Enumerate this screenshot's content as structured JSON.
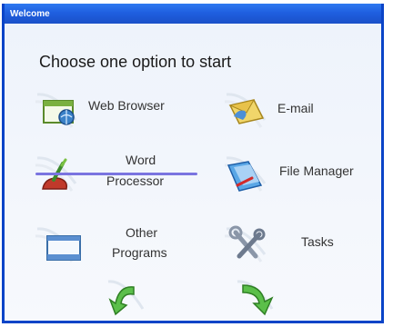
{
  "window": {
    "title": "Welcome"
  },
  "heading": "Choose one option to start",
  "options": [
    {
      "label": "Web Browser",
      "icon": "browser-window-icon"
    },
    {
      "label": "E-mail",
      "icon": "envelope-icon"
    },
    {
      "label_line1": "Word",
      "label_line2": "Processor",
      "icon": "word-processor-icon"
    },
    {
      "label": "File Manager",
      "icon": "file-manager-icon"
    },
    {
      "label_line1": "Other",
      "label_line2": "Programs",
      "icon": "other-programs-window-icon"
    },
    {
      "label": "Tasks",
      "icon": "tools-wrench-icon"
    }
  ],
  "nav": {
    "back_icon": "arrow-back-icon",
    "forward_icon": "arrow-forward-icon"
  },
  "colors": {
    "titlebar": "#1f5fe0",
    "highlight_underline": "#7a74e0",
    "arrow_green": "#3aa83a"
  }
}
